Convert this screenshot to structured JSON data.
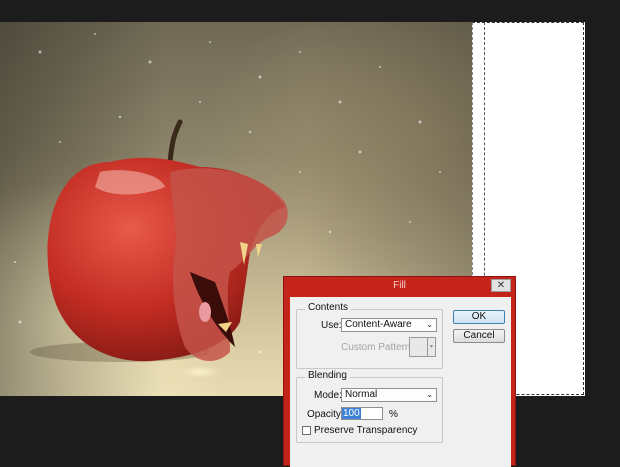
{
  "dialog": {
    "title": "Fill",
    "close_label": "✕",
    "contents": {
      "legend": "Contents",
      "use_label": "Use:",
      "use_value": "Content-Aware",
      "custom_pattern_label": "Custom Pattern:"
    },
    "blending": {
      "legend": "Blending",
      "mode_label": "Mode:",
      "mode_value": "Normal",
      "opacity_label": "Opacity:",
      "opacity_value": "100",
      "opacity_unit": "%",
      "preserve_transparency_label": "Preserve Transparency",
      "preserve_transparency_checked": false
    },
    "buttons": {
      "ok": "OK",
      "cancel": "Cancel"
    }
  },
  "canvas": {
    "image_colors": {
      "background": "#b5a987",
      "apple": "#c62a22",
      "empty_area": "#ffffff"
    }
  },
  "icons": {
    "dropdown": "chevron-down-icon",
    "close": "close-icon"
  }
}
